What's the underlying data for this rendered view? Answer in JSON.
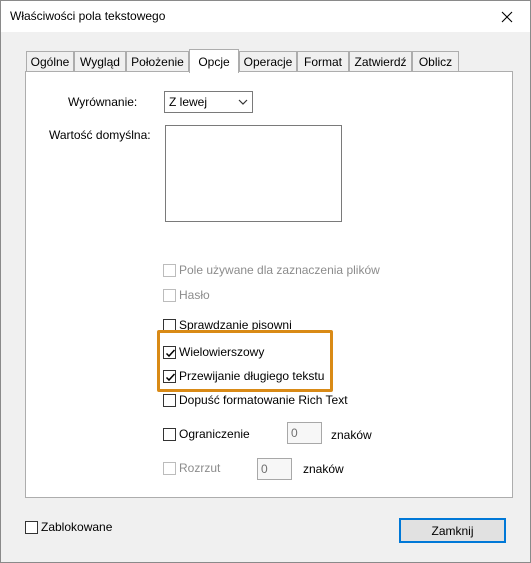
{
  "window": {
    "title": "Właściwości pola tekstowego"
  },
  "tabs": [
    {
      "label": "Ogólne"
    },
    {
      "label": "Wygląd"
    },
    {
      "label": "Położenie"
    },
    {
      "label": "Opcje",
      "active": true
    },
    {
      "label": "Operacje"
    },
    {
      "label": "Format"
    },
    {
      "label": "Zatwierdź"
    },
    {
      "label": "Oblicz"
    }
  ],
  "options": {
    "alignment_label": "Wyrównanie:",
    "alignment_value": "Z lewej",
    "default_value_label": "Wartość domyślna:",
    "default_value": "",
    "checkboxes": {
      "file_select": {
        "label": "Pole używane dla zaznaczenia plików",
        "checked": false,
        "enabled": false
      },
      "password": {
        "label": "Hasło",
        "checked": false,
        "enabled": false
      },
      "spellcheck": {
        "label": "Sprawdzanie pisowni",
        "checked": false,
        "enabled": true
      },
      "multiline": {
        "label": "Wielowierszowy",
        "checked": true,
        "enabled": true
      },
      "scroll_long": {
        "label": "Przewijanie długiego tekstu",
        "checked": true,
        "enabled": true
      },
      "rich_text": {
        "label": "Dopuść formatowanie Rich Text",
        "checked": false,
        "enabled": true
      },
      "limit": {
        "label": "Ograniczenie",
        "checked": false,
        "enabled": true
      },
      "comb": {
        "label": "Rozrzut",
        "checked": false,
        "enabled": false
      }
    },
    "limit_value": "0",
    "limit_unit": "znaków",
    "comb_value": "0",
    "comb_unit": "znaków"
  },
  "footer": {
    "locked_label": "Zablokowane",
    "locked_checked": false,
    "close_button": "Zamknij"
  },
  "highlight_color": "#d98a16"
}
